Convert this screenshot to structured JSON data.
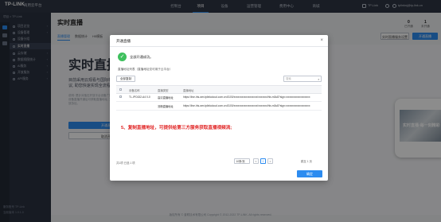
{
  "topbar": {
    "logo": "TP-LINK",
    "logo_sub": "商用云平台",
    "nav": [
      "控制台",
      "项目",
      "设备",
      "运营管理",
      "费用中心",
      "商城"
    ],
    "active_nav": 1,
    "account_label": "TP-Link",
    "user_label": "tplinknj@tp-link.cn"
  },
  "sidebar": {
    "account_line": "项目 > TP-Link",
    "items": [
      {
        "label": "项目总览"
      },
      {
        "label": "设备管理"
      },
      {
        "label": "设备分组"
      },
      {
        "label": "实时直播"
      },
      {
        "label": "云存储"
      },
      {
        "label": "数据视图统计"
      },
      {
        "label": "AI服务"
      },
      {
        "label": "开放服务"
      },
      {
        "label": "API服务"
      }
    ],
    "active_index": 3,
    "footer": [
      "服务账号 TP-Link",
      "当前版本 1.0.1.0"
    ]
  },
  "main": {
    "page_title": "实时直播",
    "tabs": [
      "直播管理",
      "数据统计",
      "H5模板"
    ],
    "active_tab": 0,
    "stats": [
      {
        "value": "0",
        "label": "已开通"
      },
      {
        "value": "1",
        "label": "未开通"
      }
    ],
    "btn_settings": "实时直播服务设置",
    "btn_open": "开通直播",
    "bg": {
      "big_title": "实时直播",
      "intro": "目前采用云观看与国际标准化协议, 助您快速实现全流程对接。",
      "intro_small": "说明: 是针对萤石开放平台设备广播管理, 将设备直播开通后可获取直播地址, 支持多种播放协议。",
      "btn_primary": "开通直播",
      "btn_outline": "取消开通",
      "phone_text": "实时直播·每一刻精彩"
    },
    "footer": "版权所有 © 普联技术有限公司 Copyright © 2012-2022 TP-LINK. All rights reserved."
  },
  "modal": {
    "title": "开通直播",
    "close": "×",
    "success_text": "全部开通成功。",
    "address_label": "直播地址列表（直播地址仅可用于云平台）",
    "copy_all": "全部复制",
    "search_placeholder": "搜索",
    "columns": [
      "设备名称",
      "直播类型",
      "直播地址"
    ],
    "rows": [
      {
        "device": "TL-IPC632-A4 0-0",
        "type": "高清直播地址",
        "url": "https://live-hls-wm.tplinkcloud.com.cn:8100/xxxxxxxxxxxxxxxxxx/xxxxxxx/hls.m3u8?sign=xxxxxxxxxxxxxxxxxx"
      },
      {
        "device": "",
        "type": "流畅直播地址",
        "url": "https://live-hls-wm.tplinkcloud.com.cn:8100/xxxxxxxxxxxxxxxxxx/xxxxxxx/hls.m3u8?sign=xxxxxxxxxxxxxxxxxx"
      }
    ],
    "annotation": "5、复制直播地址，可提供给第三方服务获取直播视频流;",
    "pagination": {
      "total_text": "共1项 已选 1 项",
      "page_size": "10条/页",
      "pages": [
        "<",
        "1",
        ">"
      ],
      "current_page": 1,
      "goto": "跳至 1 页"
    },
    "confirm": "确定"
  },
  "colors": {
    "accent": "#2d8cf0",
    "success": "#3ec05d",
    "annotation": "#e02020"
  }
}
